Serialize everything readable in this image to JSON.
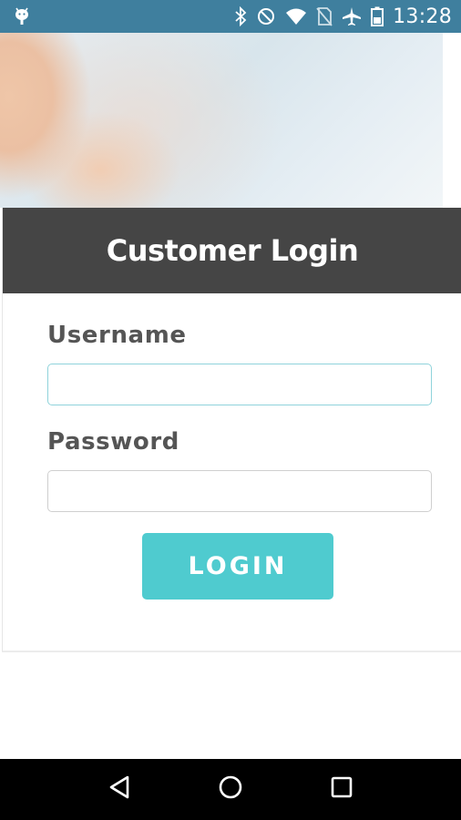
{
  "status_bar": {
    "time": "13:28",
    "background_color": "#3f7f9e",
    "icons": [
      "android-debug-icon",
      "bluetooth-icon",
      "do-not-disturb-icon",
      "wifi-icon",
      "no-sim-icon",
      "airplane-mode-icon",
      "battery-icon"
    ]
  },
  "header": {
    "title": "Customer Login",
    "background_color": "#454545"
  },
  "form": {
    "username": {
      "label": "Username",
      "value": "",
      "placeholder": ""
    },
    "password": {
      "label": "Password",
      "value": "",
      "placeholder": ""
    },
    "login_button": {
      "label": "LOGIN",
      "color": "#4fcbcf"
    }
  },
  "nav_bar": {
    "buttons": [
      "back-icon",
      "home-icon",
      "recents-icon"
    ]
  }
}
